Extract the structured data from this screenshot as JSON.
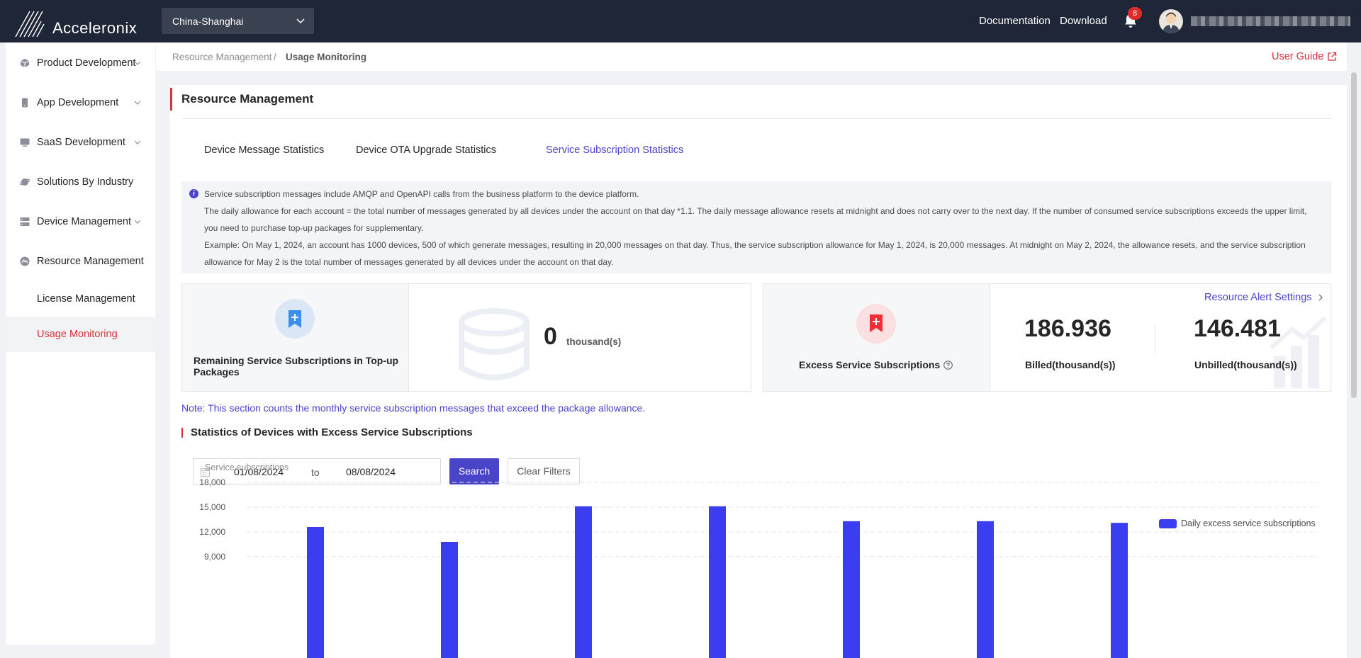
{
  "app": {
    "logo_text": "Acceleronix",
    "region": "China-Shanghai",
    "links": {
      "documentation": "Documentation",
      "download": "Download"
    },
    "notifications_count": "8"
  },
  "sidebar": {
    "items": [
      {
        "label": "Product Development",
        "icon": "cube-icon",
        "has_chevron": true
      },
      {
        "label": "App Development",
        "icon": "phone-icon",
        "has_chevron": true
      },
      {
        "label": "SaaS Development",
        "icon": "monitor-icon",
        "has_chevron": true
      },
      {
        "label": "Solutions By Industry",
        "icon": "planet-icon",
        "has_chevron": false
      },
      {
        "label": "Device Management",
        "icon": "server-icon",
        "has_chevron": true
      },
      {
        "label": "Resource Management",
        "icon": "resource-icon",
        "has_chevron": false
      }
    ],
    "sub_items": [
      {
        "label": "License Management",
        "active": false
      },
      {
        "label": "Usage Monitoring",
        "active": true
      }
    ]
  },
  "breadcrumb": {
    "parent": "Resource Management",
    "separator": "/",
    "current": "Usage Monitoring",
    "user_guide": "User Guide"
  },
  "main": {
    "title": "Resource Management",
    "tabs": [
      {
        "label": "Device Message Statistics",
        "active": false
      },
      {
        "label": "Device OTA Upgrade Statistics",
        "active": false
      },
      {
        "label": "Service Subscription Statistics",
        "active": true
      }
    ],
    "info": {
      "line1": "Service subscription messages include AMQP and OpenAPI calls from the business platform to the device platform.",
      "line2": "The daily allowance for each account = the total number of messages generated by all devices under the account on that day *1.1. The daily message allowance resets at midnight and does not carry over to the next day. If the number of consumed service subscriptions exceeds the upper limit, you need to purchase top-up packages for supplementary.",
      "line3": "Example: On May 1, 2024, an account has 1000 devices, 500 of which generate messages, resulting in 20,000 messages on that day. Thus, the service subscription allowance for May 1, 2024, is 20,000 messages. At midnight on May 2, 2024, the allowance resets, and the service subscription allowance for May 2 is the total number of messages generated by all devices under the account on that day."
    },
    "remaining": {
      "label": "Remaining Service Subscriptions in Top-up Packages",
      "value": "0",
      "unit": "thousand(s)"
    },
    "excess": {
      "label": "Excess Service Subscriptions",
      "alert_link": "Resource Alert Settings",
      "billed_value": "186.936",
      "billed_label": "Billed(thousand(s))",
      "unbilled_value": "146.481",
      "unbilled_label": "Unbilled(thousand(s))"
    },
    "note": "Note: This section counts the monthly service subscription messages that exceed the package allowance.",
    "section_title": "Statistics of Devices with Excess Service Subscriptions",
    "filters": {
      "start_date": "01/08/2024",
      "to": "to",
      "end_date": "08/08/2024",
      "search": "Search",
      "clear": "Clear Filters"
    }
  },
  "colors": {
    "accent": "#4a44c8",
    "brand_red": "#d3323a",
    "bar": "#3b3ef0",
    "topbar": "#1f2637"
  },
  "chart_data": {
    "type": "bar",
    "ylabel": "Service subscriptions",
    "legend": "Daily excess service subscriptions",
    "legend_position": "top-right",
    "y_ticks": [
      "18,000",
      "15,000",
      "12,000",
      "9,000"
    ],
    "y_tick_values": [
      18000,
      15000,
      12000,
      9000
    ],
    "grid": true,
    "categories": [
      "",
      "",
      "",
      "",
      "",
      "",
      "",
      ""
    ],
    "values": [
      12600,
      10800,
      15100,
      15100,
      13300,
      13300,
      13100
    ]
  }
}
